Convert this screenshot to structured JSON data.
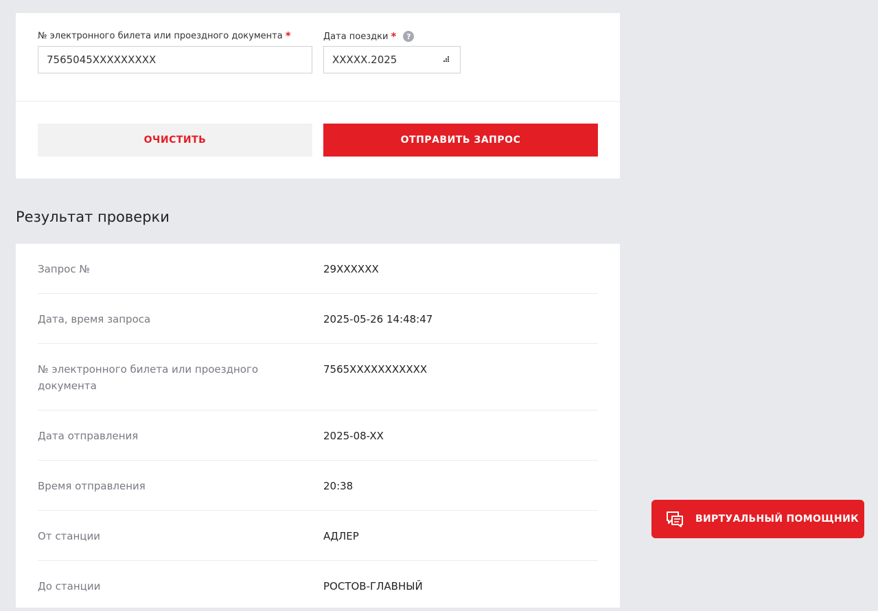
{
  "form": {
    "ticket_label": "№ электронного билета или проездного документа",
    "ticket_value": "7565045XXXXXXXXX",
    "date_label": "Дата поездки",
    "date_value": "XXXXX.2025",
    "required_mark": "*",
    "help_icon": "?",
    "clear_label": "ОЧИСТИТЬ",
    "send_label": "ОТПРАВИТЬ ЗАПРОС"
  },
  "result": {
    "title": "Результат проверки",
    "rows": [
      {
        "label": "Запрос №",
        "value": "29XXXXXX"
      },
      {
        "label": "Дата, время запроса",
        "value": "2025-05-26 14:48:47"
      },
      {
        "label": "№ электронного билета или проездного документа",
        "value": "7565XXXXXXXXXXX"
      },
      {
        "label": "Дата отправления",
        "value": "2025-08-XX"
      },
      {
        "label": "Время отправления",
        "value": "20:38"
      },
      {
        "label": "От станции",
        "value": "АДЛЕР"
      },
      {
        "label": "До станции",
        "value": "РОСТОВ-ГЛАВНЫЙ"
      }
    ]
  },
  "assistant": {
    "label": "ВИРТУАЛЬНЫЙ ПОМОЩНИК",
    "icon": "chat-icon"
  },
  "colors": {
    "accent": "#e31e24",
    "background": "#e8e9ed"
  }
}
